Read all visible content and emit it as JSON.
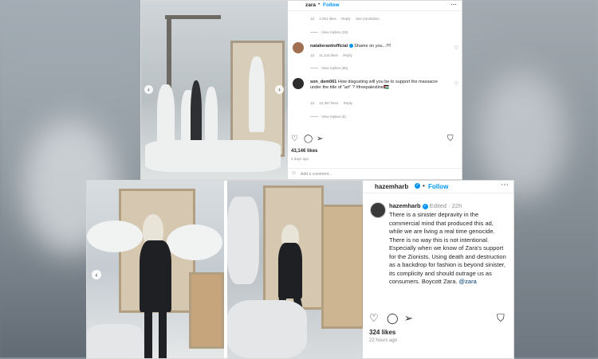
{
  "top_post": {
    "username": "zara",
    "follow_label": "Follow",
    "comments": [
      {
        "meta": {
          "age": "1d",
          "likes": "2,061 likes",
          "reply": "Reply",
          "translate": "See translation"
        },
        "view_replies": "View replies (28)"
      },
      {
        "author": "natalierantiofficial",
        "text": "Shame on you...!!!!",
        "meta": {
          "age": "1d",
          "likes": "11,415 likes",
          "reply": "Reply"
        },
        "view_replies": "View replies (86)"
      },
      {
        "author": "son_dem061",
        "text": "How disgusting will you be to support the massacre under the title of \"art\" ? #freepalestine🇵🇸",
        "meta": {
          "age": "1d",
          "likes": "12,367 likes",
          "reply": "Reply"
        },
        "view_replies": "View replies (8)"
      }
    ],
    "likes": "43,146 likes",
    "time": "3 days ago",
    "add_comment_placeholder": "Add a comment..."
  },
  "bottom_post": {
    "username": "hazemharb",
    "follow_label": "Follow",
    "edited": "Edited",
    "age": "22h",
    "caption": "There is a sinister depravity in the commercial mind that produced this ad, while we are living a real time genocide. There is no way this is not intentional. Especially when we know of Zara's support for the Zionists. Using death and destruction as a backdrop for fashion is beyond sinister, its complicity and should outrage us as consumers. Boycott Zara.",
    "mention": "@zara",
    "likes": "324 likes",
    "time": "22 hours ago"
  }
}
